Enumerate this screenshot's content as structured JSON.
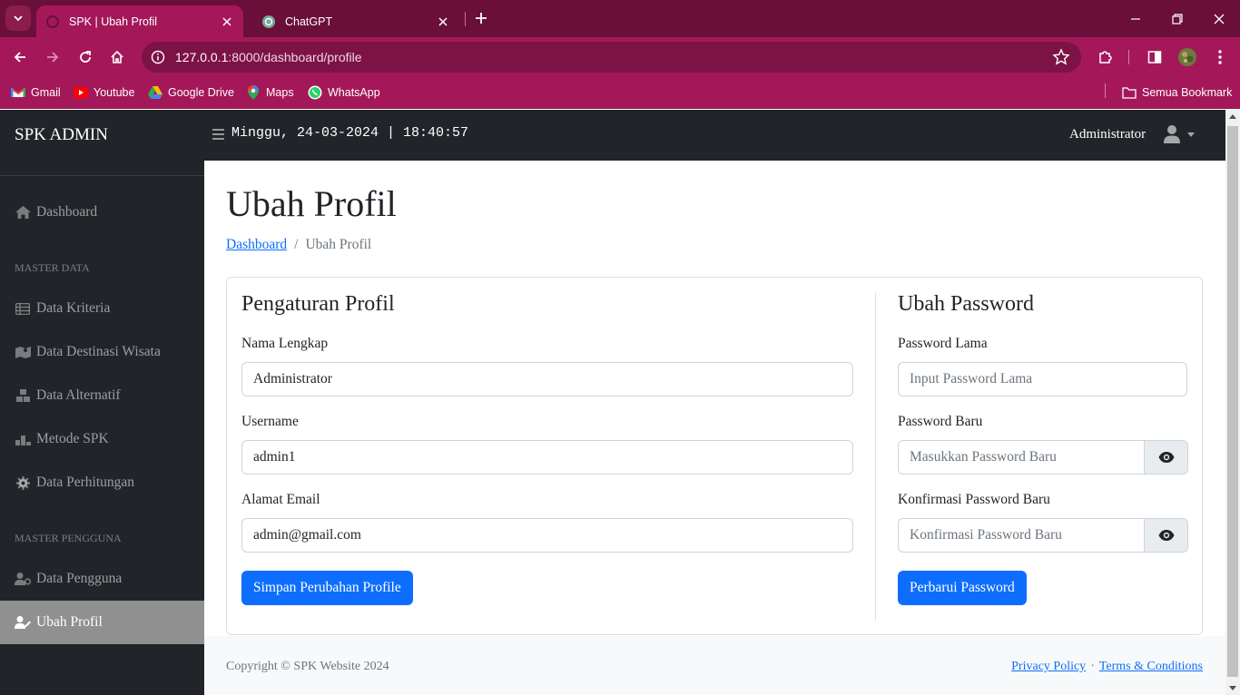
{
  "browser": {
    "tabs": [
      {
        "title": "SPK | Ubah Profil",
        "active": true
      },
      {
        "title": "ChatGPT",
        "active": false
      }
    ],
    "url_host": "127.0.0.1",
    "url_rest": ":8000/dashboard/profile",
    "bookmarks": [
      "Gmail",
      "Youtube",
      "Google Drive",
      "Maps",
      "WhatsApp"
    ],
    "all_bookmarks": "Semua Bookmark",
    "colors": {
      "frame": "#6a0f3a",
      "toolbar": "#a4185a"
    }
  },
  "sidebar": {
    "brand": "SPK ADMIN",
    "dashboard": "Dashboard",
    "heading_master_data": "MASTER DATA",
    "items": [
      "Data Kriteria",
      "Data Destinasi Wisata",
      "Data Alternatif",
      "Metode SPK",
      "Data Perhitungan"
    ],
    "heading_master_pengguna": "MASTER PENGGUNA",
    "users": [
      "Data Pengguna",
      "Ubah Profil"
    ]
  },
  "topbar": {
    "datetime": "Minggu, 24-03-2024 | 18:40:57",
    "user": "Administrator"
  },
  "page": {
    "title": "Ubah Profil",
    "breadcrumb": {
      "link": "Dashboard",
      "separator": "/",
      "current": "Ubah Profil"
    }
  },
  "profile": {
    "title": "Pengaturan Profil",
    "name_label": "Nama Lengkap",
    "name_value": "Administrator",
    "username_label": "Username",
    "username_value": "admin1",
    "email_label": "Alamat Email",
    "email_value": "admin@gmail.com",
    "save_button": "Simpan Perubahan Profile"
  },
  "password": {
    "title": "Ubah Password",
    "old_label": "Password Lama",
    "old_placeholder": "Input Password Lama",
    "new_label": "Password Baru",
    "new_placeholder": "Masukkan Password Baru",
    "confirm_label": "Konfirmasi Password Baru",
    "confirm_placeholder": "Konfirmasi Password Baru",
    "update_button": "Perbarui Password"
  },
  "footer": {
    "copyright": "Copyright © SPK Website 2024",
    "privacy": "Privacy Policy",
    "separator": "·",
    "terms": "Terms & Conditions"
  },
  "colors": {
    "primary": "#0d6efd",
    "sidebar": "#212529",
    "active_nav": "#909090"
  }
}
